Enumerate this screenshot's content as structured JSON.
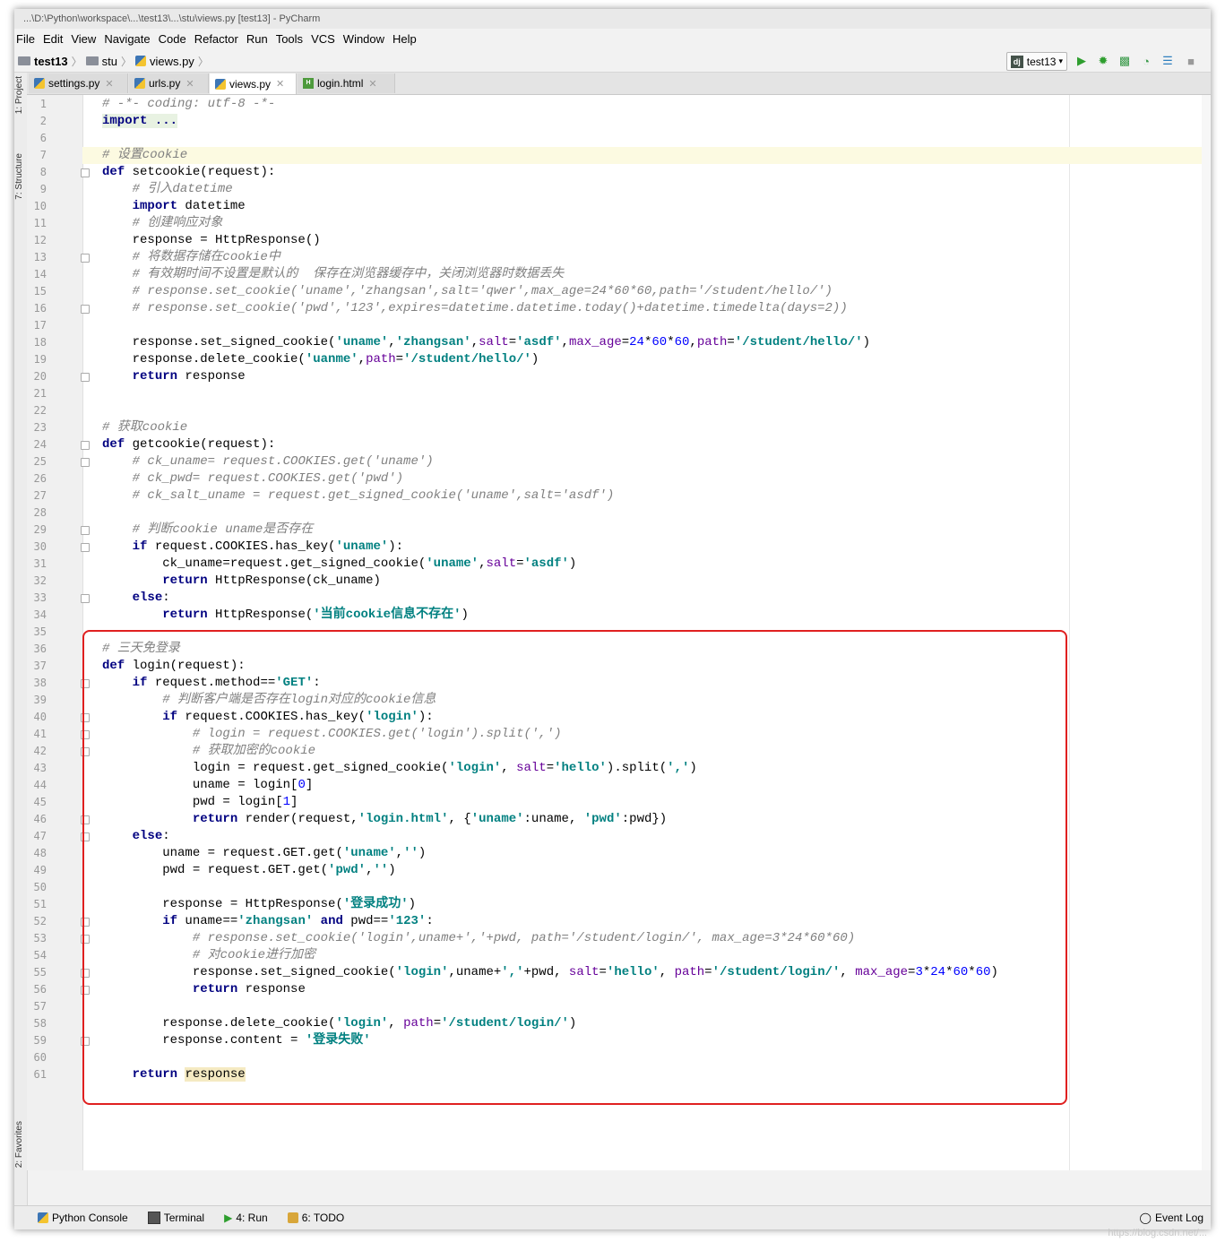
{
  "window": {
    "title": "...\\D:\\Python\\workspace\\...\\test13\\...\\stu\\views.py [test13] - PyCharm"
  },
  "menu": {
    "items": [
      "File",
      "Edit",
      "View",
      "Navigate",
      "Code",
      "Refactor",
      "Run",
      "Tools",
      "VCS",
      "Window",
      "Help"
    ]
  },
  "breadcrumb": {
    "project": "test13",
    "folder": "stu",
    "file": "views.py"
  },
  "run_config": {
    "label": "test13"
  },
  "tabs": [
    {
      "label": "settings.py",
      "icon": "python-file-icon"
    },
    {
      "label": "urls.py",
      "icon": "python-file-icon"
    },
    {
      "label": "views.py",
      "icon": "python-file-icon",
      "active": true
    },
    {
      "label": "login.html",
      "icon": "html-file-icon"
    }
  ],
  "left_tools": [
    "1: Project",
    "7: Structure",
    "2: Favorites"
  ],
  "bottom_tools": [
    {
      "label": "Python Console",
      "icon": "python-console-icon"
    },
    {
      "label": "Terminal",
      "icon": "terminal-icon"
    },
    {
      "label": "4: Run",
      "icon": "run-icon"
    },
    {
      "label": "6: TODO",
      "icon": "todo-icon"
    },
    {
      "label": "Event Log",
      "icon": "event-log-icon"
    }
  ],
  "watermark": "https://blog.csdn.net/...",
  "code": {
    "lines": [
      {
        "n": "1",
        "t": "# -*- coding: utf-8 -*-"
      },
      {
        "n": "2",
        "t": "import ..."
      },
      {
        "n": "6",
        "t": ""
      },
      {
        "n": "7",
        "t": "# 设置cookie"
      },
      {
        "n": "8",
        "t": "def setcookie(request):"
      },
      {
        "n": "9",
        "t": "    # 引入datetime"
      },
      {
        "n": "10",
        "t": "    import datetime"
      },
      {
        "n": "11",
        "t": "    # 创建响应对象"
      },
      {
        "n": "12",
        "t": "    response = HttpResponse()"
      },
      {
        "n": "13",
        "t": "    # 将数据存储在cookie中"
      },
      {
        "n": "14",
        "t": "    # 有效期时间不设置是默认的  保存在浏览器缓存中，关闭浏览器时数据丢失"
      },
      {
        "n": "15",
        "t": "    # response.set_cookie('uname','zhangsan',salt='qwer',max_age=24*60*60,path='/student/hello/')"
      },
      {
        "n": "16",
        "t": "    # response.set_cookie('pwd','123',expires=datetime.datetime.today()+datetime.timedelta(days=2))"
      },
      {
        "n": "17",
        "t": ""
      },
      {
        "n": "18",
        "t": "    response.set_signed_cookie('uname','zhangsan',salt='asdf',max_age=24*60*60,path='/student/hello/')"
      },
      {
        "n": "19",
        "t": "    response.delete_cookie('uanme',path='/student/hello/')"
      },
      {
        "n": "20",
        "t": "    return response"
      },
      {
        "n": "21",
        "t": ""
      },
      {
        "n": "22",
        "t": ""
      },
      {
        "n": "23",
        "t": "# 获取cookie"
      },
      {
        "n": "24",
        "t": "def getcookie(request):"
      },
      {
        "n": "25",
        "t": "    # ck_uname= request.COOKIES.get('uname')"
      },
      {
        "n": "26",
        "t": "    # ck_pwd= request.COOKIES.get('pwd')"
      },
      {
        "n": "27",
        "t": "    # ck_salt_uname = request.get_signed_cookie('uname',salt='asdf')"
      },
      {
        "n": "28",
        "t": ""
      },
      {
        "n": "29",
        "t": "    # 判断cookie uname是否存在"
      },
      {
        "n": "30",
        "t": "    if request.COOKIES.has_key('uname'):"
      },
      {
        "n": "31",
        "t": "        ck_uname=request.get_signed_cookie('uname',salt='asdf')"
      },
      {
        "n": "32",
        "t": "        return HttpResponse(ck_uname)"
      },
      {
        "n": "33",
        "t": "    else:"
      },
      {
        "n": "34",
        "t": "        return HttpResponse('当前cookie信息不存在')"
      },
      {
        "n": "35",
        "t": ""
      },
      {
        "n": "36",
        "t": "# 三天免登录"
      },
      {
        "n": "37",
        "t": "def login(request):"
      },
      {
        "n": "38",
        "t": "    if request.method=='GET':"
      },
      {
        "n": "39",
        "t": "        # 判断客户端是否存在login对应的cookie信息"
      },
      {
        "n": "40",
        "t": "        if request.COOKIES.has_key('login'):"
      },
      {
        "n": "41",
        "t": "            # login = request.COOKIES.get('login').split(',')"
      },
      {
        "n": "42",
        "t": "            # 获取加密的cookie"
      },
      {
        "n": "43",
        "t": "            login = request.get_signed_cookie('login', salt='hello').split(',')"
      },
      {
        "n": "44",
        "t": "            uname = login[0]"
      },
      {
        "n": "45",
        "t": "            pwd = login[1]"
      },
      {
        "n": "46",
        "t": "            return render(request,'login.html', {'uname':uname, 'pwd':pwd})"
      },
      {
        "n": "47",
        "t": "    else:"
      },
      {
        "n": "48",
        "t": "        uname = request.GET.get('uname','')"
      },
      {
        "n": "49",
        "t": "        pwd = request.GET.get('pwd','')"
      },
      {
        "n": "50",
        "t": ""
      },
      {
        "n": "51",
        "t": "        response = HttpResponse('登录成功')"
      },
      {
        "n": "52",
        "t": "        if uname=='zhangsan' and pwd=='123':"
      },
      {
        "n": "53",
        "t": "            # response.set_cookie('login',uname+','+pwd, path='/student/login/', max_age=3*24*60*60)"
      },
      {
        "n": "54",
        "t": "            # 对cookie进行加密"
      },
      {
        "n": "55",
        "t": "            response.set_signed_cookie('login',uname+','+pwd, salt='hello', path='/student/login/', max_age=3*24*60*60)"
      },
      {
        "n": "56",
        "t": "            return response"
      },
      {
        "n": "57",
        "t": ""
      },
      {
        "n": "58",
        "t": "        response.delete_cookie('login', path='/student/login/')"
      },
      {
        "n": "59",
        "t": "        response.content = '登录失败'"
      },
      {
        "n": "60",
        "t": ""
      },
      {
        "n": "61",
        "t": "    return response"
      }
    ]
  },
  "colors": {
    "keyword": "#000080",
    "string": "#008080",
    "comment": "#808080",
    "param": "#660099",
    "number": "#0000ff",
    "highlight_box": "#e02020",
    "current_line": "#fcfae1"
  }
}
